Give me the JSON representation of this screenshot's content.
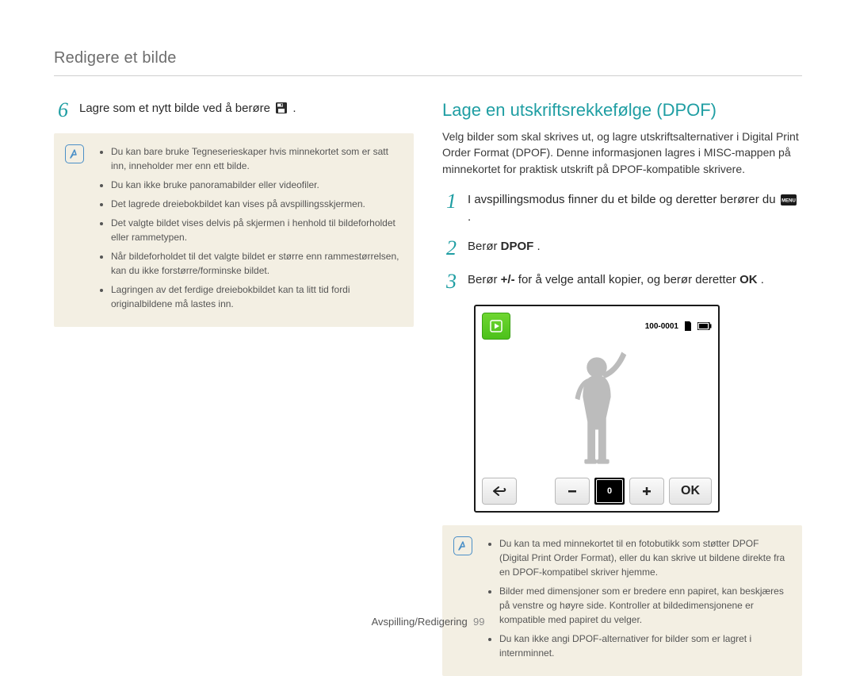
{
  "header": {
    "title": "Redigere et bilde"
  },
  "left": {
    "step6": {
      "num": "6",
      "text_before": "Lagre som et nytt bilde ved å berøre ",
      "text_after": "."
    },
    "note": {
      "items": [
        "Du kan bare bruke Tegneserieskaper hvis minnekortet som er satt inn, inneholder mer enn ett bilde.",
        "Du kan ikke bruke panoramabilder eller videofiler.",
        "Det lagrede dreiebokbildet kan vises på avspillingsskjermen.",
        "Det valgte bildet vises delvis på skjermen i henhold til bildeforholdet eller rammetypen.",
        "Når bildeforholdet til det valgte bildet er større enn rammestørrelsen, kan du ikke forstørre/forminske bildet.",
        "Lagringen av det ferdige dreiebokbildet kan ta litt tid fordi originalbildene må lastes inn."
      ]
    }
  },
  "right": {
    "title": "Lage en utskriftsrekkefølge (DPOF)",
    "intro": "Velg bilder som skal skrives ut, og lagre utskriftsalternativer i Digital Print Order Format (DPOF). Denne informasjonen lagres i MISC-mappen på minnekortet for praktisk utskrift på DPOF-kompatible skrivere.",
    "step1": {
      "num": "1",
      "text_before": "I avspillingsmodus finner du et bilde og deretter berører du ",
      "text_after": "."
    },
    "step2": {
      "num": "2",
      "text_before": "Berør ",
      "bold": "DPOF",
      "text_after": "."
    },
    "step3": {
      "num": "3",
      "text_before": "Berør ",
      "bold": "+/-",
      "text_mid": " for å velge antall kopier, og berør deretter ",
      "ok": "OK",
      "text_after": "."
    },
    "screen": {
      "file_label": "100-0001",
      "copies": "0",
      "ok_label": "OK"
    },
    "note": {
      "items": [
        "Du kan ta med minnekortet til en fotobutikk som støtter DPOF (Digital Print Order Format), eller du kan skrive ut bildene direkte fra en DPOF-kompatibel skriver hjemme.",
        "Bilder med dimensjoner som er bredere enn papiret, kan beskjæres på venstre og høyre side. Kontroller at bildedimensjonene er kompatible med papiret du velger.",
        "Du kan ikke angi DPOF-alternativer for bilder som er lagret i internminnet."
      ]
    }
  },
  "footer": {
    "section": "Avspilling/Redigering",
    "page": "99"
  }
}
